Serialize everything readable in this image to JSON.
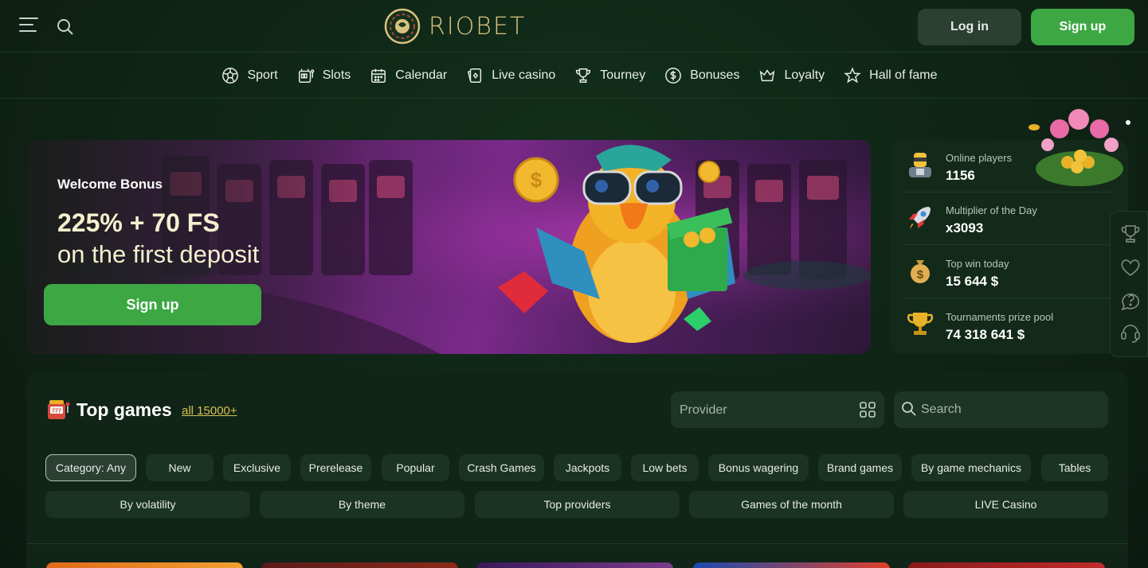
{
  "header": {
    "logo_text": "RIOBET",
    "login_label": "Log in",
    "signup_label": "Sign up"
  },
  "nav": [
    {
      "label": "Sport",
      "icon": "soccer-ball-icon"
    },
    {
      "label": "Slots",
      "icon": "slot-machine-icon"
    },
    {
      "label": "Calendar",
      "icon": "calendar-icon"
    },
    {
      "label": "Live casino",
      "icon": "live-casino-icon"
    },
    {
      "label": "Tourney",
      "icon": "trophy-icon"
    },
    {
      "label": "Bonuses",
      "icon": "dollar-coin-icon"
    },
    {
      "label": "Loyalty",
      "icon": "crown-icon"
    },
    {
      "label": "Hall of fame",
      "icon": "star-icon"
    }
  ],
  "banner": {
    "welcome": "Welcome Bonus",
    "headline": "225% + 70 FS",
    "subline": "on the first deposit",
    "signup_label": "Sign up"
  },
  "stats": [
    {
      "label": "Online players",
      "value": "1156",
      "icon": "player-icon"
    },
    {
      "label": "Multiplier of the Day",
      "value": "x3093",
      "icon": "rocket-icon"
    },
    {
      "label": "Top win today",
      "value": "15 644 $",
      "icon": "money-bag-icon"
    },
    {
      "label": "Tournaments prize pool",
      "value": "74 318 641 $",
      "icon": "gold-cup-icon"
    }
  ],
  "top_games": {
    "title": "Top games",
    "all_link": "all 15000+",
    "provider_placeholder": "Provider",
    "search_placeholder": "Search"
  },
  "chips_row1": [
    "Category: Any",
    "New",
    "Exclusive",
    "Prerelease",
    "Popular",
    "Crash Games",
    "Jackpots",
    "Low bets",
    "Bonus wagering",
    "Brand games",
    "By game mechanics",
    "Tables"
  ],
  "chips_row2": [
    "By volatility",
    "By theme",
    "Top providers",
    "Games of the month",
    "LIVE Casino"
  ],
  "colors": {
    "accent_green": "#3da744",
    "logo_gold": "#d9c27e",
    "link_gold": "#d9c34e",
    "background": "#0d1d12"
  }
}
